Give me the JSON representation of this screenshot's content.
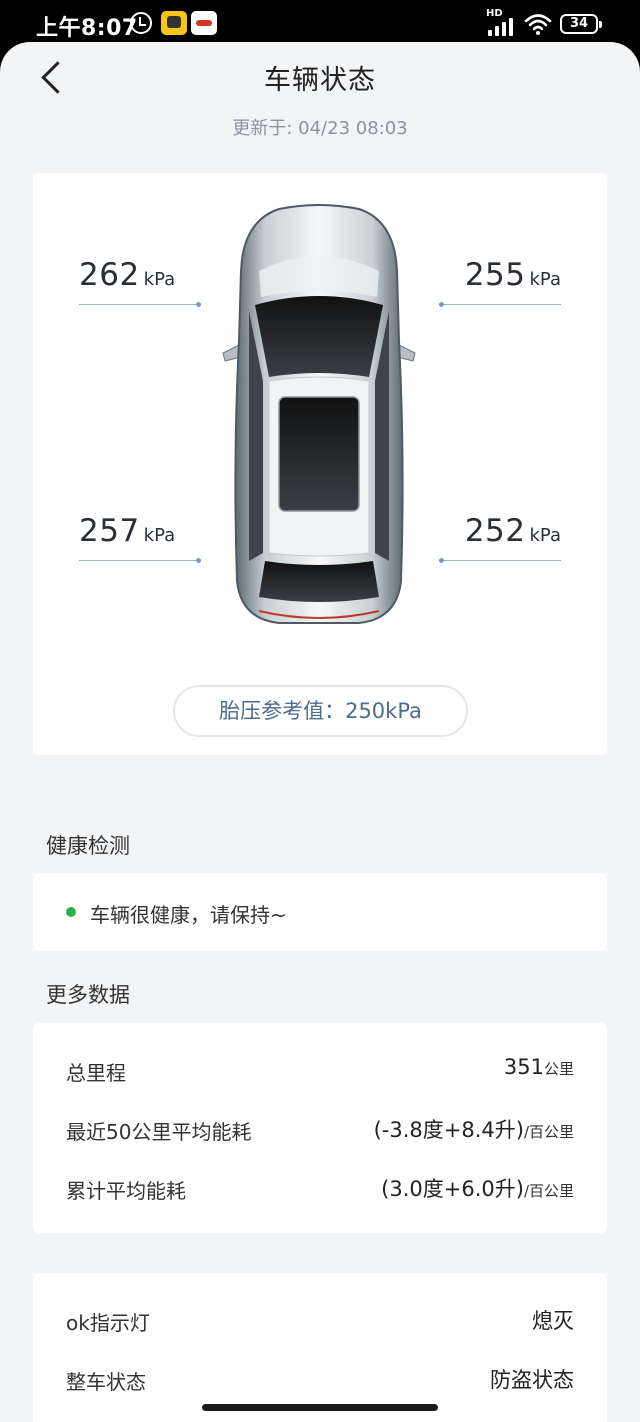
{
  "status_bar": {
    "time": "上午8:07",
    "network": "HD",
    "battery": "34"
  },
  "header": {
    "title": "车辆状态",
    "updated_label": "更新于: 04/23 08:03"
  },
  "tire_pressure": {
    "unit": "kPa",
    "front_left": "262",
    "front_right": "255",
    "rear_left": "257",
    "rear_right": "252",
    "reference": "胎压参考值：250kPa"
  },
  "health": {
    "section_title": "健康检测",
    "status_text": "车辆很健康，请保持~",
    "status_color": "#2ab34d"
  },
  "more_data": {
    "section_title": "更多数据",
    "rows": [
      {
        "label": "总里程",
        "value": "351",
        "unit": "公里"
      },
      {
        "label": "最近50公里平均能耗",
        "value": "(-3.8度+8.4升)",
        "unit": "/百公里"
      },
      {
        "label": "累计平均能耗",
        "value": "(3.0度+6.0升)",
        "unit": "/百公里"
      }
    ]
  },
  "status_rows": [
    {
      "label": "ok指示灯",
      "value": "熄灭"
    },
    {
      "label": "整车状态",
      "value": "防盗状态"
    }
  ]
}
